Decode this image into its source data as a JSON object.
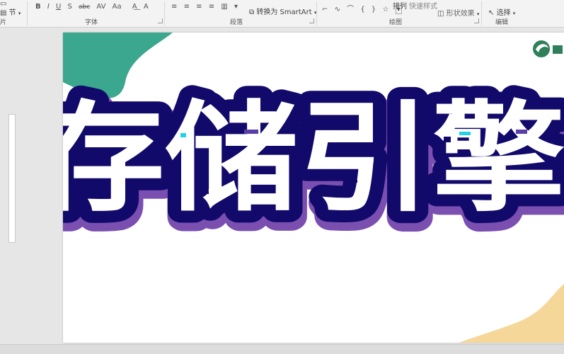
{
  "ribbon": {
    "clipboard": {
      "item1": "片",
      "item2": "节"
    },
    "font": {
      "label": "字体",
      "buttons": [
        "B",
        "I",
        "U",
        "S",
        "abc",
        "AV",
        "Aa",
        "A"
      ]
    },
    "paragraph": {
      "label": "段落",
      "smartart": "转换为 SmartArt"
    },
    "drawing": {
      "label": "绘图",
      "arrange": "排列",
      "quick_styles": "快速样式",
      "shape_effects": "形状效果"
    },
    "editing": {
      "label": "编辑",
      "select": "选择"
    }
  },
  "slide": {
    "title": "存储引擎",
    "colors": {
      "teal": "#3aa78e",
      "navy": "#120a6b",
      "purple": "#7a4fb0",
      "fill": "#ffffff",
      "sand": "#f5d79a"
    }
  }
}
